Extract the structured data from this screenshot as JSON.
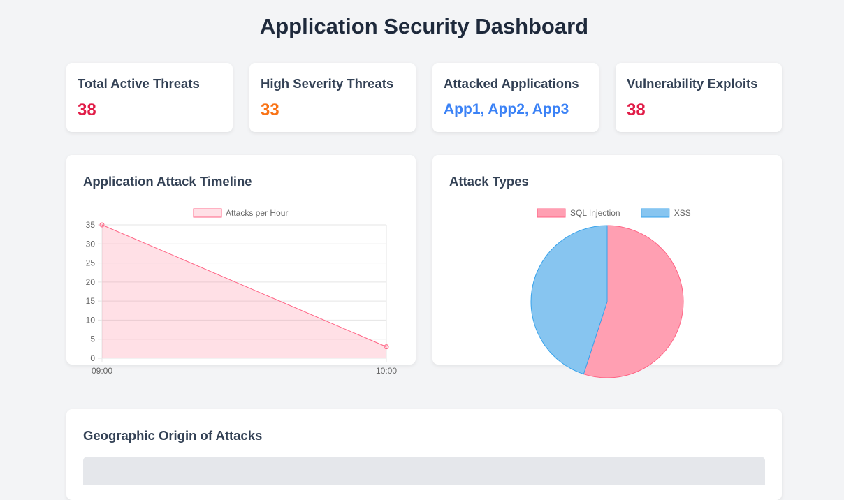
{
  "page": {
    "title": "Application Security Dashboard"
  },
  "stats": [
    {
      "label": "Total Active Threats",
      "value": "38",
      "color": "#e11d48"
    },
    {
      "label": "High Severity Threats",
      "value": "33",
      "color": "#f97316"
    },
    {
      "label": "Attacked Applications",
      "value": "App1, App2, App3",
      "color": "#3b82f6"
    },
    {
      "label": "Vulnerability Exploits",
      "value": "38",
      "color": "#e11d48"
    }
  ],
  "panels": {
    "timeline": {
      "title": "Application Attack Timeline"
    },
    "attack_types": {
      "title": "Attack Types"
    },
    "geo": {
      "title": "Geographic Origin of Attacks"
    }
  },
  "chart_data": [
    {
      "type": "area",
      "x": [
        "09:00",
        "10:00"
      ],
      "series": [
        {
          "name": "Attacks per Hour",
          "values": [
            35,
            3
          ],
          "color": "#ff6384"
        }
      ],
      "ylim": [
        0,
        35
      ],
      "yticks": [
        0,
        5,
        10,
        15,
        20,
        25,
        30,
        35
      ],
      "grid": true,
      "legend": "top"
    },
    {
      "type": "pie",
      "labels": [
        "SQL Injection",
        "XSS"
      ],
      "values": [
        55,
        45
      ],
      "colors": [
        "#ff9fb2",
        "#87c5f0"
      ],
      "border_colors": [
        "#ff6384",
        "#36a2eb"
      ],
      "legend": "top"
    }
  ]
}
